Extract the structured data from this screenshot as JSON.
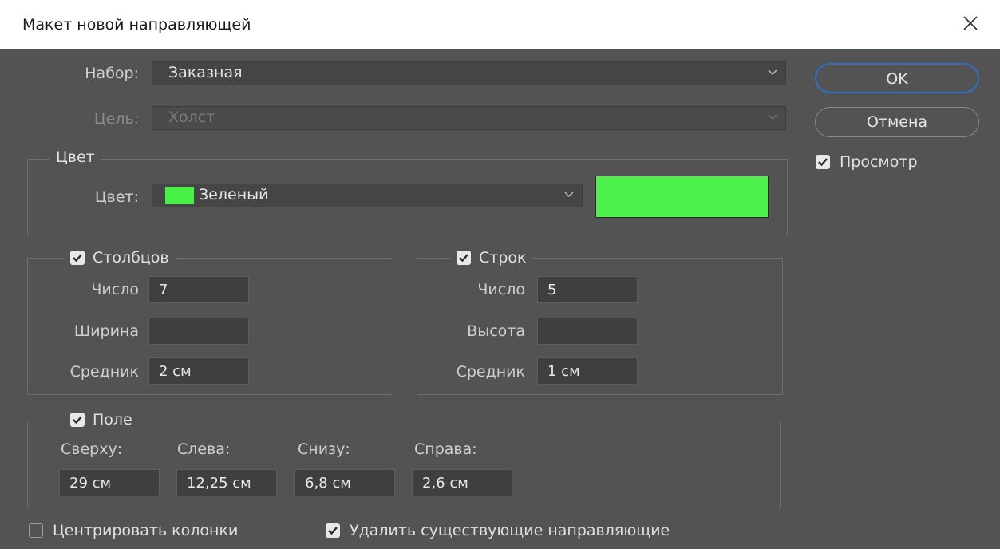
{
  "dialog": {
    "title": "Макет новой направляющей"
  },
  "preset": {
    "label": "Набор:",
    "value": "Заказная"
  },
  "target": {
    "label": "Цель:",
    "value": "Холст"
  },
  "color_group": {
    "legend": "Цвет",
    "label": "Цвет:",
    "value": "Зеленый",
    "swatch_color": "#4ef04e"
  },
  "columns": {
    "legend": "Столбцов",
    "checked": true,
    "number_label": "Число",
    "number_value": "7",
    "width_label": "Ширина",
    "width_value": "",
    "gutter_label": "Средник",
    "gutter_value": "2 см"
  },
  "rows": {
    "legend": "Строк",
    "checked": true,
    "number_label": "Число",
    "number_value": "5",
    "height_label": "Высота",
    "height_value": "",
    "gutter_label": "Средник",
    "gutter_value": "1 см"
  },
  "margin": {
    "legend": "Поле",
    "checked": true,
    "top_label": "Сверху:",
    "top_value": "29 см",
    "left_label": "Слева:",
    "left_value": "12,25 см",
    "bottom_label": "Снизу:",
    "bottom_value": "6,8 см",
    "right_label": "Справа:",
    "right_value": "2,6 см"
  },
  "options": {
    "center_columns": {
      "label": "Центрировать колонки",
      "checked": false
    },
    "remove_existing": {
      "label": "Удалить существующие направляющие",
      "checked": true
    }
  },
  "buttons": {
    "ok": "OK",
    "cancel": "Отмена"
  },
  "preview": {
    "label": "Просмотр",
    "checked": true
  },
  "colors": {
    "accent": "#2e6fc8",
    "background": "#535353",
    "green": "#4ef04e"
  }
}
